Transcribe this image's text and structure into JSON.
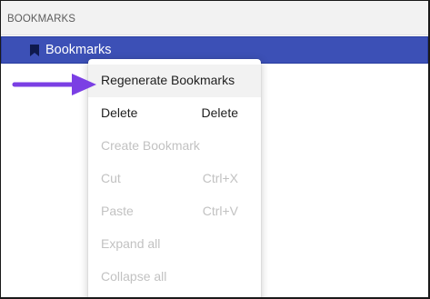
{
  "panel": {
    "title": "BOOKMARKS"
  },
  "tree": {
    "root_label": "Bookmarks",
    "selected_color": "#3c50b6"
  },
  "context_menu": {
    "items": [
      {
        "label": "Regenerate Bookmarks",
        "shortcut": "",
        "enabled": true,
        "highlighted": true
      },
      {
        "label": "Delete",
        "shortcut": "Delete",
        "enabled": true,
        "highlighted": false
      },
      {
        "label": "Create Bookmark",
        "shortcut": "",
        "enabled": false,
        "highlighted": false
      },
      {
        "label": "Cut",
        "shortcut": "Ctrl+X",
        "enabled": false,
        "highlighted": false
      },
      {
        "label": "Paste",
        "shortcut": "Ctrl+V",
        "enabled": false,
        "highlighted": false
      },
      {
        "label": "Expand all",
        "shortcut": "",
        "enabled": false,
        "highlighted": false
      },
      {
        "label": "Collapse all",
        "shortcut": "",
        "enabled": false,
        "highlighted": false
      }
    ]
  },
  "annotation": {
    "arrow_color": "#7b3fe4",
    "arrow_icon": "pointer-arrow-icon"
  }
}
